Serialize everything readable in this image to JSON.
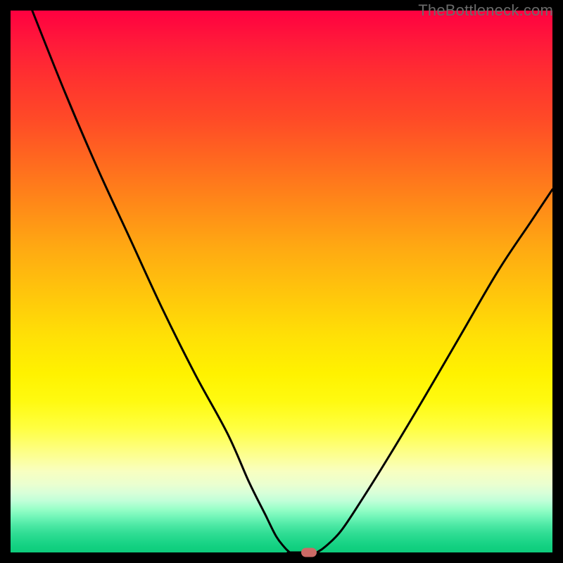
{
  "watermark": "TheBottleneck.com",
  "chart_data": {
    "type": "line",
    "title": "",
    "xlabel": "",
    "ylabel": "",
    "xlim": [
      0,
      100
    ],
    "ylim": [
      0,
      100
    ],
    "grid": false,
    "background": {
      "gradient": "vertical",
      "stops": [
        {
          "pos": 0,
          "color": "#ff0040"
        },
        {
          "pos": 50,
          "color": "#ffc000"
        },
        {
          "pos": 80,
          "color": "#ffff60"
        },
        {
          "pos": 100,
          "color": "#0ecc7c"
        }
      ]
    },
    "series": [
      {
        "name": "left-branch",
        "x": [
          4,
          10,
          16,
          22,
          28,
          34,
          40,
          44,
          47,
          49,
          50.5,
          51.5
        ],
        "y": [
          100,
          85,
          71,
          58,
          45,
          33,
          22,
          13,
          7,
          3,
          1,
          0
        ]
      },
      {
        "name": "baseline",
        "x": [
          51.5,
          56.5
        ],
        "y": [
          0,
          0
        ]
      },
      {
        "name": "right-branch",
        "x": [
          56.5,
          58,
          61,
          65,
          70,
          76,
          83,
          90,
          96,
          100
        ],
        "y": [
          0,
          1,
          4,
          10,
          18,
          28,
          40,
          52,
          61,
          67
        ]
      }
    ],
    "marker": {
      "x": 55,
      "y": 0,
      "color": "#cc6a66"
    }
  },
  "curve_stroke": "#000000",
  "curve_width": 3
}
